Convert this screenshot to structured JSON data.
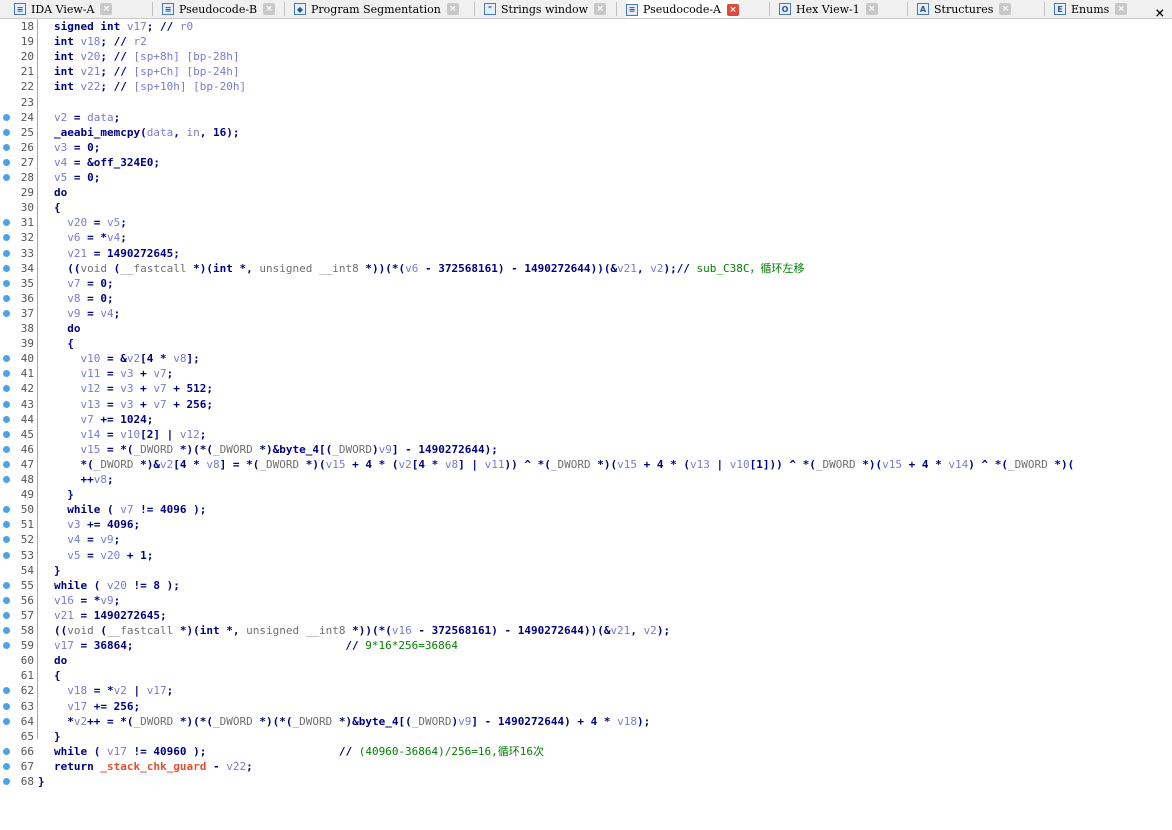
{
  "tabs": [
    {
      "label": "IDA View-A",
      "icon": "ida-view-icon",
      "active": false
    },
    {
      "label": "Pseudocode-B",
      "icon": "pseudocode-icon",
      "active": false
    },
    {
      "label": "Program Segmentation",
      "icon": "segmentation-icon",
      "active": false
    },
    {
      "label": "Strings window",
      "icon": "strings-icon",
      "active": false
    },
    {
      "label": "Pseudocode-A",
      "icon": "pseudocode-icon",
      "active": true
    },
    {
      "label": "Hex View-1",
      "icon": "hex-view-icon",
      "active": false
    },
    {
      "label": "Structures",
      "icon": "structures-icon",
      "active": false
    },
    {
      "label": "Enums",
      "icon": "enums-icon",
      "active": false
    }
  ],
  "tab_close_glyph": "×",
  "lines": [
    {
      "n": "18",
      "bp": false,
      "t": "signed int v17; // r0"
    },
    {
      "n": "19",
      "bp": false,
      "t": "int v18; // r2"
    },
    {
      "n": "20",
      "bp": false,
      "t": "int v20; // [sp+8h] [bp-28h]"
    },
    {
      "n": "21",
      "bp": false,
      "t": "int v21; // [sp+Ch] [bp-24h]"
    },
    {
      "n": "22",
      "bp": false,
      "t": "int v22; // [sp+10h] [bp-20h]"
    },
    {
      "n": "23",
      "bp": false,
      "t": ""
    },
    {
      "n": "24",
      "bp": true,
      "t": "v2 = data;"
    },
    {
      "n": "25",
      "bp": true,
      "t": "_aeabi_memcpy(data, in, 16);"
    },
    {
      "n": "26",
      "bp": true,
      "t": "v3 = 0;"
    },
    {
      "n": "27",
      "bp": true,
      "t": "v4 = &off_324E0;"
    },
    {
      "n": "28",
      "bp": true,
      "t": "v5 = 0;"
    },
    {
      "n": "29",
      "bp": false,
      "t": "do"
    },
    {
      "n": "30",
      "bp": false,
      "t": "{"
    },
    {
      "n": "31",
      "bp": true,
      "t": "  v20 = v5;"
    },
    {
      "n": "32",
      "bp": true,
      "t": "  v6 = *v4;"
    },
    {
      "n": "33",
      "bp": true,
      "t": "  v21 = 1490272645;"
    },
    {
      "n": "34",
      "bp": true,
      "t": "  ((void (__fastcall *)(int *, unsigned __int8 *))(*(v6 - 372568161) - 1490272644))(&v21, v2);// sub_C38C，循环左移"
    },
    {
      "n": "35",
      "bp": true,
      "t": "  v7 = 0;"
    },
    {
      "n": "36",
      "bp": true,
      "t": "  v8 = 0;"
    },
    {
      "n": "37",
      "bp": true,
      "t": "  v9 = v4;"
    },
    {
      "n": "38",
      "bp": false,
      "t": "  do"
    },
    {
      "n": "39",
      "bp": false,
      "t": "  {"
    },
    {
      "n": "40",
      "bp": true,
      "t": "    v10 = &v2[4 * v8];"
    },
    {
      "n": "41",
      "bp": true,
      "t": "    v11 = v3 + v7;"
    },
    {
      "n": "42",
      "bp": true,
      "t": "    v12 = v3 + v7 + 512;"
    },
    {
      "n": "43",
      "bp": true,
      "t": "    v13 = v3 + v7 + 256;"
    },
    {
      "n": "44",
      "bp": true,
      "t": "    v7 += 1024;"
    },
    {
      "n": "45",
      "bp": true,
      "t": "    v14 = v10[2] | v12;"
    },
    {
      "n": "46",
      "bp": true,
      "t": "    v15 = *(_DWORD *)(*(_DWORD *)&byte_4[(_DWORD)v9] - 1490272644);"
    },
    {
      "n": "47",
      "bp": true,
      "t": "    *(_DWORD *)&v2[4 * v8] = *(_DWORD *)(v15 + 4 * (v2[4 * v8] | v11)) ^ *(_DWORD *)(v15 + 4 * (v13 | v10[1])) ^ *(_DWORD *)(v15 + 4 * v14) ^ *(_DWORD *)("
    },
    {
      "n": "48",
      "bp": true,
      "t": "    ++v8;"
    },
    {
      "n": "49",
      "bp": false,
      "t": "  }"
    },
    {
      "n": "50",
      "bp": true,
      "t": "  while ( v7 != 4096 );"
    },
    {
      "n": "51",
      "bp": true,
      "t": "  v3 += 4096;"
    },
    {
      "n": "52",
      "bp": true,
      "t": "  v4 = v9;"
    },
    {
      "n": "53",
      "bp": true,
      "t": "  v5 = v20 + 1;"
    },
    {
      "n": "54",
      "bp": false,
      "t": "}"
    },
    {
      "n": "55",
      "bp": true,
      "t": "while ( v20 != 8 );"
    },
    {
      "n": "56",
      "bp": true,
      "t": "v16 = *v9;"
    },
    {
      "n": "57",
      "bp": true,
      "t": "v21 = 1490272645;"
    },
    {
      "n": "58",
      "bp": true,
      "t": "((void (__fastcall *)(int *, unsigned __int8 *))(*(v16 - 372568161) - 1490272644))(&v21, v2);"
    },
    {
      "n": "59",
      "bp": true,
      "t": "v17 = 36864;                                // 9*16*256=36864"
    },
    {
      "n": "60",
      "bp": false,
      "t": "do"
    },
    {
      "n": "61",
      "bp": false,
      "t": "{"
    },
    {
      "n": "62",
      "bp": true,
      "t": "  v18 = *v2 | v17;"
    },
    {
      "n": "63",
      "bp": true,
      "t": "  v17 += 256;"
    },
    {
      "n": "64",
      "bp": true,
      "t": "  *v2++ = *(_DWORD *)(*(_DWORD *)(*(_DWORD *)&byte_4[(_DWORD)v9] - 1490272644) + 4 * v18);"
    },
    {
      "n": "65",
      "bp": false,
      "t": "}"
    },
    {
      "n": "66",
      "bp": true,
      "t": "while ( v17 != 40960 );                    // (40960-36864)/256=16,循环16次"
    },
    {
      "n": "67",
      "bp": true,
      "t": "return _stack_chk_guard - v22;"
    },
    {
      "n": "68",
      "bp": true,
      "t": "}"
    }
  ],
  "colors": {
    "keyword": "#000080",
    "variable": "#7a7ad0",
    "comment": "#008000",
    "stack_guard": "#e05030",
    "breakpoint_dot": "#4ea3e6",
    "active_tab_close": "#e04a3a"
  }
}
